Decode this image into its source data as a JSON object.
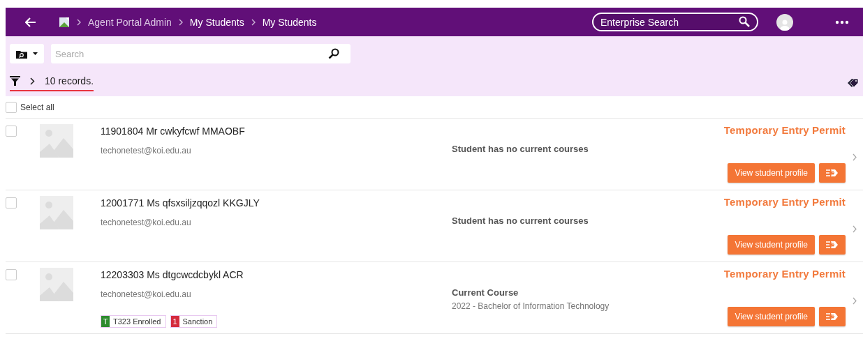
{
  "breadcrumb": [
    {
      "label": "Agent Portal Admin",
      "current": false
    },
    {
      "label": "My Students",
      "current": true
    },
    {
      "label": "My Students",
      "current": true
    }
  ],
  "enterprise_search": {
    "placeholder": "Enterprise Search"
  },
  "search": {
    "placeholder": "Search"
  },
  "records": "10 records.",
  "select_all": {
    "label": "Select all",
    "checked": false
  },
  "students": [
    {
      "title": "11901804 Mr cwkyfcwf MMAOBF",
      "email": "techonetest@koi.edu.au",
      "checked": false,
      "course_heading": "Student has no current courses",
      "visa": "Temporary Entry Permit",
      "button": "View student profile"
    },
    {
      "title": "12001771 Ms qfsxsiljzqqozl KKGJLY",
      "email": "techonetest@koi.edu.au",
      "checked": false,
      "course_heading": "Student has no current courses",
      "visa": "Temporary Entry Permit",
      "button": "View student profile"
    },
    {
      "title": "12203303 Ms dtgcwcdcbykl ACR",
      "email": "techonetest@koi.edu.au",
      "checked": false,
      "course_heading": "Current Course",
      "course": "2022 - Bachelor of Information Technology",
      "visa": "Temporary Entry Permit",
      "button": "View student profile",
      "tags": [
        {
          "code": "T",
          "label": "T323 Enrolled",
          "color": "#2e8b2e"
        },
        {
          "code": "1",
          "label": "Sanction",
          "color": "#d42a3e"
        }
      ]
    }
  ]
}
